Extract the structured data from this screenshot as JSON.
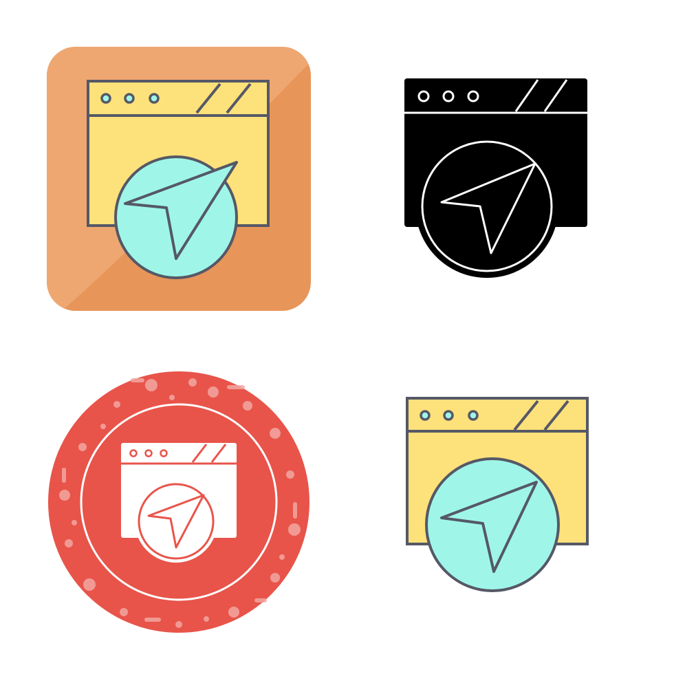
{
  "icon_set": {
    "subject": "browser-navigation-icon",
    "variants": [
      {
        "style": "colored-rounded-square",
        "icon": "browser-navigation-icon"
      },
      {
        "style": "solid-glyph",
        "icon": "browser-navigation-icon"
      },
      {
        "style": "grunge-circle-badge",
        "icon": "browser-navigation-icon"
      },
      {
        "style": "filled-line",
        "icon": "browser-navigation-icon"
      }
    ]
  },
  "colors": {
    "background": "#ffffff",
    "tile_orange": "#e8955a",
    "tile_orange_light": "#f0ae7a",
    "window_yellow": "#fde17a",
    "circle_mint": "#9ff6e8",
    "outline_gray": "#555866",
    "glyph_black": "#000000",
    "badge_red": "#e8544a",
    "badge_light": "#f3a7a2",
    "white": "#ffffff"
  }
}
